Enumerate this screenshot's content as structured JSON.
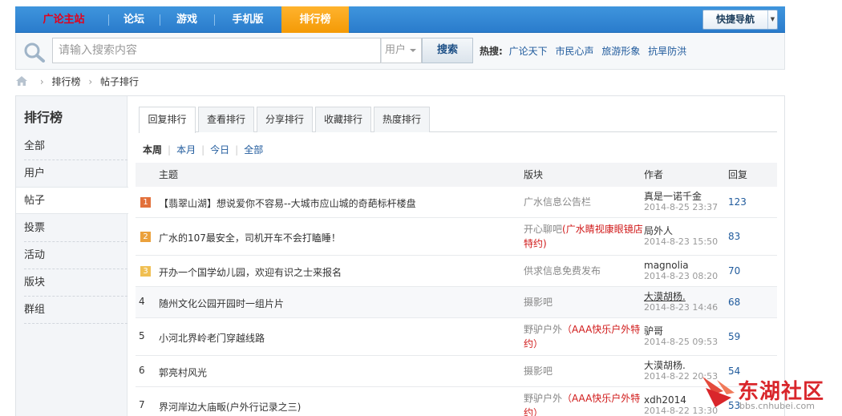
{
  "nav": {
    "items": [
      {
        "label": "广论主站"
      },
      {
        "label": "论坛"
      },
      {
        "label": "游戏"
      },
      {
        "label": "手机版"
      },
      {
        "label": "排行榜"
      }
    ],
    "quick_nav_label": "快捷导航"
  },
  "search": {
    "placeholder": "请输入搜索内容",
    "type_value": "用户",
    "button_label": "搜索",
    "hot_label": "热搜:",
    "hot_links": [
      "广论天下",
      "市民心声",
      "旅游形象",
      "抗旱防洪"
    ]
  },
  "breadcrumb": [
    "排行榜",
    "帖子排行"
  ],
  "sidebar": {
    "title": "排行榜",
    "items": [
      "全部",
      "用户",
      "帖子",
      "投票",
      "活动",
      "版块",
      "群组"
    ]
  },
  "tabs": [
    "回复排行",
    "查看排行",
    "分享排行",
    "收藏排行",
    "热度排行"
  ],
  "filters": [
    "本周",
    "本月",
    "今日",
    "全部"
  ],
  "table": {
    "headers": {
      "subject": "主题",
      "forum": "版块",
      "author": "作者",
      "replies": "回复"
    },
    "rows": [
      {
        "rank": "1",
        "subject": "【翡翠山湖】想说爱你不容易--大城市应山城的奇葩标杆楼盘",
        "forum": "广水信息公告栏",
        "forum_red": "",
        "author": "真是一诺千金",
        "date": "2014-8-25 23:37",
        "replies": "123"
      },
      {
        "rank": "2",
        "subject": "广水的107最安全，司机开车不会打瞌睡！",
        "forum": "开心聊吧",
        "forum_red": "(广水睛视康眼镜店特约)",
        "author": "局外人",
        "date": "2014-8-23 15:50",
        "replies": "83"
      },
      {
        "rank": "3",
        "subject": "开办一个国学幼儿园，欢迎有识之士来报名",
        "forum": "供求信息免费发布",
        "forum_red": "",
        "author": "magnolia",
        "date": "2014-8-23 08:20",
        "replies": "70"
      },
      {
        "rank": "4",
        "subject": "随州文化公园开园时一组片片",
        "forum": "摄影吧",
        "forum_red": "",
        "author": "大漠胡杨.",
        "date": "2014-8-23 14:46",
        "replies": "68"
      },
      {
        "rank": "5",
        "subject": "小河北界岭老门穿越线路",
        "forum": "野驴户外",
        "forum_red": "（AAA快乐户外特约）",
        "author": "驴哥",
        "date": "2014-8-25 09:53",
        "replies": "59"
      },
      {
        "rank": "6",
        "subject": "郭亮村风光",
        "forum": "摄影吧",
        "forum_red": "",
        "author": "大漠胡杨.",
        "date": "2014-8-22 20:53",
        "replies": "54"
      },
      {
        "rank": "7",
        "subject": "界河岸边大庙畈(户外行记录之三)",
        "forum": "野驴户外",
        "forum_red": "（AAA快乐户外特约）",
        "author": "xdh2014",
        "date": "2014-8-22 13:30",
        "replies": "53"
      }
    ]
  },
  "watermark": {
    "name": "东湖社区",
    "url": "bbs.cnhubei.com"
  },
  "colors": {
    "nav_blue": "#2a7ccc",
    "nav_active": "#f49a06",
    "home_red": "#e4001b",
    "link_blue": "#1f5a9c",
    "rank1": "#e2703a",
    "rank2": "#eba13c",
    "rank3": "#f0bf52"
  }
}
